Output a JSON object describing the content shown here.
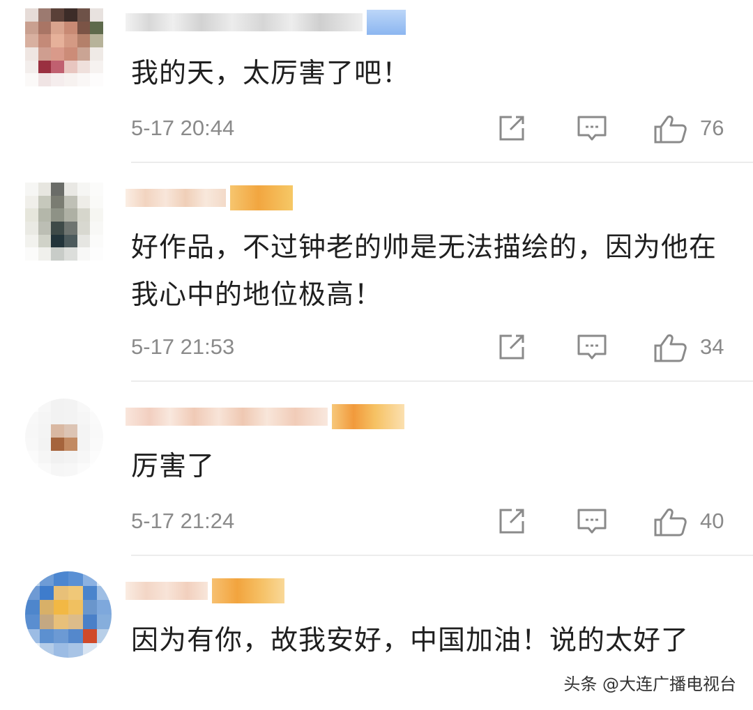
{
  "comments": [
    {
      "text": "我的天，太厉害了吧！",
      "time": "5-17 20:44",
      "likes": "76"
    },
    {
      "text": "好作品，不过钟老的帅是无法描绘的，因为他在我心中的地位极高！",
      "time": "5-17 21:53",
      "likes": "34"
    },
    {
      "text": "厉害了",
      "time": "5-17 21:24",
      "likes": "40"
    },
    {
      "text": "因为有你，故我安好，中国加油！说的太好了",
      "time": "",
      "likes": ""
    }
  ],
  "icons": {
    "share": "share-icon",
    "reply": "comment-icon",
    "like": "thumbs-up-icon"
  },
  "watermark": "头条 @大连广播电视台",
  "colors": {
    "meta_text": "#8a8a8a",
    "body_text": "#1f1f1f",
    "divider": "#ececec"
  }
}
